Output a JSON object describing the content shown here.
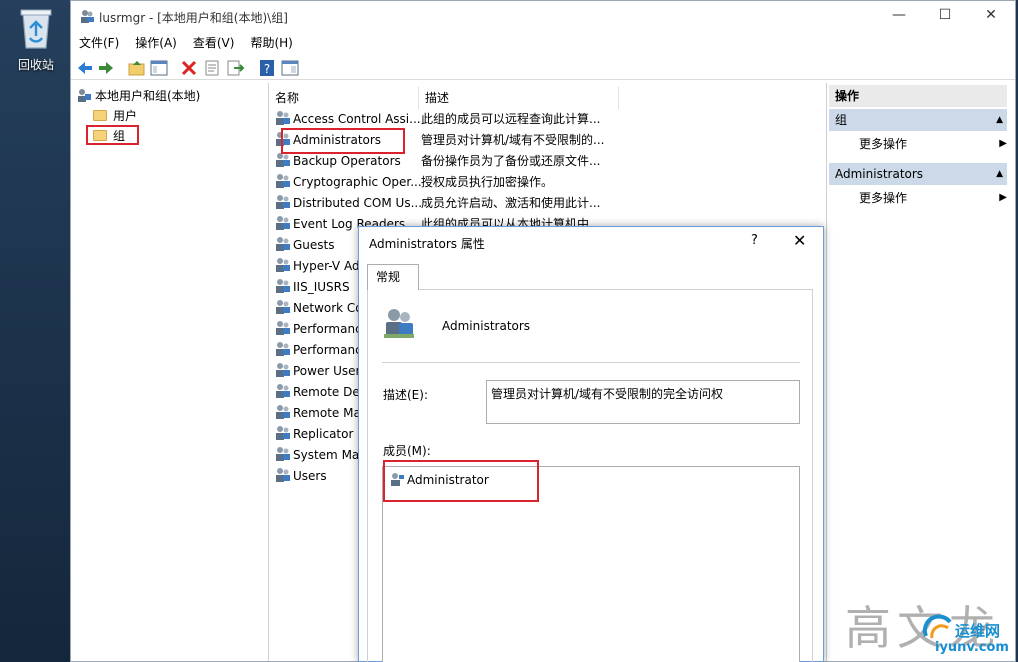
{
  "desktop": {
    "recycle_bin_label": "回收站"
  },
  "window": {
    "title": "lusrmgr - [本地用户和组(本地)\\组]",
    "controls": {
      "minimize": "—",
      "maximize": "☐",
      "close": "✕"
    }
  },
  "menu": [
    "文件(F)",
    "操作(A)",
    "查看(V)",
    "帮助(H)"
  ],
  "tree": {
    "root": "本地用户和组(本地)",
    "children": [
      "用户",
      "组"
    ]
  },
  "list": {
    "columns": [
      "名称",
      "描述"
    ],
    "rows": [
      {
        "name": "Access Control Assi...",
        "desc": "此组的成员可以远程查询此计算..."
      },
      {
        "name": "Administrators",
        "desc": "管理员对计算机/域有不受限制的..."
      },
      {
        "name": "Backup Operators",
        "desc": "备份操作员为了备份或还原文件..."
      },
      {
        "name": "Cryptographic Oper...",
        "desc": "授权成员执行加密操作。"
      },
      {
        "name": "Distributed COM Us...",
        "desc": "成员允许启动、激活和使用此计..."
      },
      {
        "name": "Event Log Readers",
        "desc": "此组的成员可以从本地计算机中..."
      },
      {
        "name": "Guests",
        "desc": ""
      },
      {
        "name": "Hyper-V Ad",
        "desc": ""
      },
      {
        "name": "IIS_IUSRS",
        "desc": ""
      },
      {
        "name": "Network Co",
        "desc": ""
      },
      {
        "name": "Performanc",
        "desc": ""
      },
      {
        "name": "Performanc",
        "desc": ""
      },
      {
        "name": "Power User",
        "desc": ""
      },
      {
        "name": "Remote Des",
        "desc": ""
      },
      {
        "name": "Remote Ma",
        "desc": ""
      },
      {
        "name": "Replicator",
        "desc": ""
      },
      {
        "name": "System Mar",
        "desc": ""
      },
      {
        "name": "Users",
        "desc": ""
      }
    ]
  },
  "actions": {
    "header": "操作",
    "sections": [
      {
        "title": "组",
        "item": "更多操作"
      },
      {
        "title": "Administrators",
        "item": "更多操作"
      }
    ]
  },
  "dialog": {
    "title": "Administrators 属性",
    "help": "?",
    "close": "✕",
    "tab": "常规",
    "group_name": "Administrators",
    "desc_label": "描述(E):",
    "desc_value": "管理员对计算机/域有不受限制的完全访问权",
    "members_label": "成员(M):",
    "members": [
      "Administrator"
    ]
  },
  "watermark": {
    "main": "高文龙",
    "site_cn": "运维网",
    "site": "iyunv.com"
  },
  "colors": {
    "highlight": "#d9232e",
    "action_section_bg": "#cbd9e8",
    "dialog_border": "#6b9dd8"
  }
}
